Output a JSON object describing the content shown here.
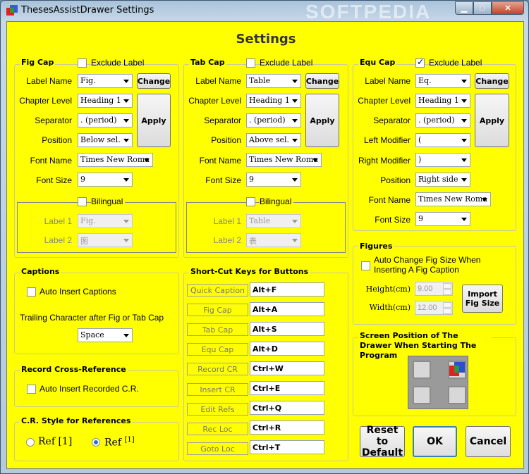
{
  "window": {
    "title": "ThesesAssistDrawer Settings",
    "watermark": "SOFTPEDIA",
    "settings_title": "Settings"
  },
  "fig_cap": {
    "heading": "Fig Cap",
    "exclude_label": "Exclude Label",
    "exclude_checked": false,
    "label_name_lbl": "Label Name",
    "label_name": "Fig.",
    "change": "Change",
    "chapter_level_lbl": "Chapter Level",
    "chapter_level": "Heading 1",
    "separator_lbl": "Separator",
    "separator": ". (period)",
    "position_lbl": "Position",
    "position": "Below sel.",
    "apply": "Apply",
    "font_name_lbl": "Font Name",
    "font_name": "Times New Roma",
    "font_size_lbl": "Font Size",
    "font_size": "9",
    "bilingual": "Bilingual",
    "label1_lbl": "Label 1",
    "label1": "Fig.",
    "label2_lbl": "Label 2",
    "label2": "图"
  },
  "tab_cap": {
    "heading": "Tab Cap",
    "exclude_label": "Exclude Label",
    "exclude_checked": false,
    "label_name_lbl": "Label Name",
    "label_name": "Table",
    "change": "Change",
    "chapter_level_lbl": "Chapter Level",
    "chapter_level": "Heading 1",
    "separator_lbl": "Separator",
    "separator": ". (period)",
    "position_lbl": "Position",
    "position": "Above sel.",
    "apply": "Apply",
    "font_name_lbl": "Font Name",
    "font_name": "Times New Roma",
    "font_size_lbl": "Font Size",
    "font_size": "9",
    "bilingual": "Bilingual",
    "label1_lbl": "Label 1",
    "label1": "Table",
    "label2_lbl": "Label 2",
    "label2": "表"
  },
  "equ_cap": {
    "heading": "Equ Cap",
    "exclude_label": "Exclude Label",
    "exclude_checked": true,
    "label_name_lbl": "Label Name",
    "label_name": "Eq.",
    "change": "Change",
    "chapter_level_lbl": "Chapter Level",
    "chapter_level": "Heading 1",
    "separator_lbl": "Separator",
    "separator": ". (period)",
    "left_modifier_lbl": "Left Modifier",
    "left_modifier": "(",
    "apply": "Apply",
    "right_modifier_lbl": "Right Modifier",
    "right_modifier": ")",
    "position_lbl": "Position",
    "position": "Right side",
    "font_name_lbl": "Font Name",
    "font_name": "Times New Roma",
    "font_size_lbl": "Font Size",
    "font_size": "9"
  },
  "captions": {
    "heading": "Captions",
    "auto_insert": "Auto Insert Captions",
    "trailing_lbl": "Trailing Character after Fig or Tab Cap",
    "trailing": "Space"
  },
  "cross_ref": {
    "heading": "Record Cross-Reference",
    "auto_insert": "Auto Insert Recorded C.R."
  },
  "cr_style": {
    "heading": "C.R. Style for References",
    "opt1": "Ref [1]",
    "opt2": "Ref",
    "opt2_sup": "[1]"
  },
  "shortcuts": {
    "heading": "Short-Cut Keys for Buttons",
    "items": [
      {
        "label": "Quick Caption",
        "key": "Alt+F"
      },
      {
        "label": "Fig Cap",
        "key": "Alt+A"
      },
      {
        "label": "Tab Cap",
        "key": "Alt+S"
      },
      {
        "label": "Equ Cap",
        "key": "Alt+D"
      },
      {
        "label": "Record CR",
        "key": "Ctrl+W"
      },
      {
        "label": "Insert CR",
        "key": "Ctrl+E"
      },
      {
        "label": "Edit Refs",
        "key": "Ctrl+Q"
      },
      {
        "label": "Rec Loc",
        "key": "Ctrl+R"
      },
      {
        "label": "Goto Loc",
        "key": "Ctrl+T"
      }
    ]
  },
  "figures": {
    "heading": "Figures",
    "auto_change": "Auto Change Fig Size When Inserting A Fig Caption",
    "height_lbl": "Height(cm)",
    "height": "9.00",
    "width_lbl": "Width(cm)",
    "width": "12.00",
    "import": "Import Fig Size"
  },
  "screen_pos": {
    "heading": "Screen Position of The Drawer When Starting The Program"
  },
  "buttons": {
    "reset": "Reset to Default",
    "ok": "OK",
    "cancel": "Cancel"
  },
  "colors": {
    "background": "#ffff00",
    "accent": "#1e4e9a"
  }
}
